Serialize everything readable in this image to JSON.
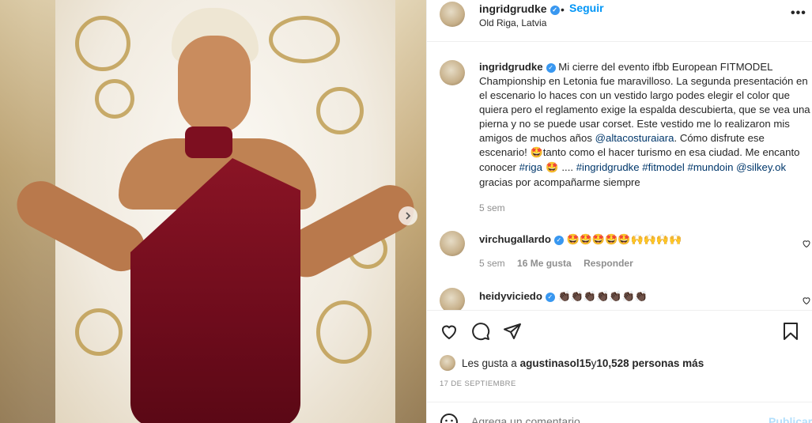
{
  "post": {
    "username": "ingridgrudke",
    "follow_label": "Seguir",
    "location": "Old Riga, Latvia",
    "more_label": "•••",
    "separator": "•"
  },
  "caption": {
    "username": "ingridgrudke",
    "text_1": "Mi cierre del evento ifbb European FITMODEL Championship en Letonia fue maravilloso. La segunda presentación en el escenario lo haces con un vestido largo podes elegir el color que quiera pero el reglamento exige la espalda descubierta, que se vea una pierna y no se puede usar corset. Este vestido me lo realizaron mis amigos de muchos años ",
    "mention_1": "@altacosturaiara",
    "text_2": ". Cómo disfrute ese escenario! ",
    "emoji_1": "🤩",
    "text_3": "tanto como el hacer turismo en esa ciudad. Me encanto conocer ",
    "tag_riga": "#riga",
    "emoji_2": " 🤩 ",
    "text_4": ".... ",
    "tag_ingrid": "#ingridgrudke",
    "tag_fitmodel": "#fitmodel",
    "tag_mundoin": "#mundoin",
    "mention_2": "@silkey.ok",
    "text_5": " gracias por acompañarme siempre",
    "time": "5 sem"
  },
  "comments": [
    {
      "username": "virchugallardo",
      "text": "🤩🤩🤩🤩🤩🙌🙌🙌🙌",
      "time": "5 sem",
      "likes": "16 Me gusta",
      "reply": "Responder"
    },
    {
      "username": "heidyviciedo",
      "text": "👏🏿👏🏿👏🏿👏🏿👏🏿👏🏿👏🏿"
    }
  ],
  "likes": {
    "prefix": "Les gusta a ",
    "user": "agustinasol15",
    "middle": " y ",
    "count": "10,528 personas más"
  },
  "date": "17 DE SEPTIEMBRE",
  "comment_box": {
    "placeholder": "Agrega un comentario...",
    "publish_label": "Publicar"
  },
  "icons": {
    "heart": "heart-icon",
    "comment": "comment-icon",
    "share": "share-icon",
    "save": "bookmark-icon",
    "next": "chevron-right-icon",
    "emoji": "smile-icon"
  },
  "colors": {
    "link": "#00376b",
    "follow": "#0095f6",
    "muted": "#8e8e8e",
    "verified": "#3897f0"
  }
}
